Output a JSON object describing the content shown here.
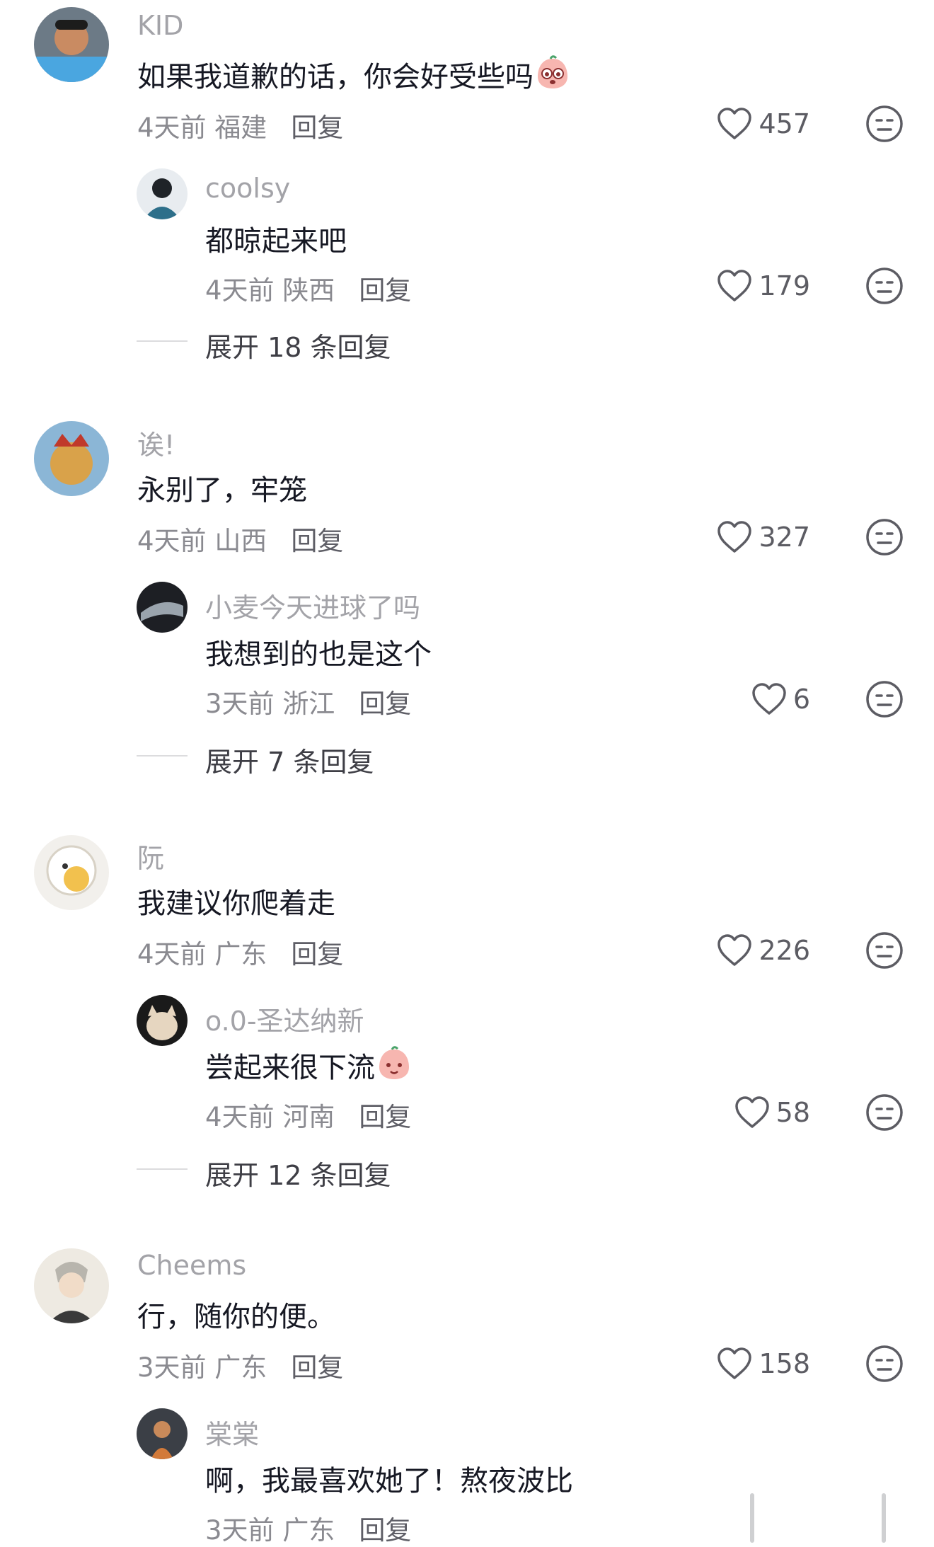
{
  "reply_label": "回复",
  "colors": {
    "username": "#a3a3a8",
    "text": "#161823",
    "meta": "#8a8a90",
    "icon": "#5c5c63"
  },
  "threads": [
    {
      "comment": {
        "user": "KID",
        "text": "如果我道歉的话，你会好受些吗",
        "time": "4天前",
        "region": "福建",
        "likes": "457"
      },
      "reply": {
        "user": "coolsy",
        "text": "都晾起来吧",
        "time": "4天前",
        "region": "陕西",
        "likes": "179"
      },
      "expand": "展开 18 条回复"
    },
    {
      "comment": {
        "user": "诶!",
        "text": "永别了，牢笼",
        "time": "4天前",
        "region": "山西",
        "likes": "327"
      },
      "reply": {
        "user": "小麦今天进球了吗",
        "text": "我想到的也是这个",
        "time": "3天前",
        "region": "浙江",
        "likes": "6"
      },
      "expand": "展开 7 条回复"
    },
    {
      "comment": {
        "user": "阮",
        "text": "我建议你爬着走",
        "time": "4天前",
        "region": "广东",
        "likes": "226"
      },
      "reply": {
        "user": "o.0-圣达纳新",
        "text": "尝起来很下流",
        "time": "4天前",
        "region": "河南",
        "likes": "58"
      },
      "expand": "展开 12 条回复"
    },
    {
      "comment": {
        "user": "Cheems",
        "text": "行，随你的便。",
        "time": "3天前",
        "region": "广东",
        "likes": "158"
      },
      "reply": {
        "user": "棠棠",
        "text": "啊，我最喜欢她了！熬夜波比",
        "time": "3天前",
        "region": "广东"
      }
    }
  ]
}
